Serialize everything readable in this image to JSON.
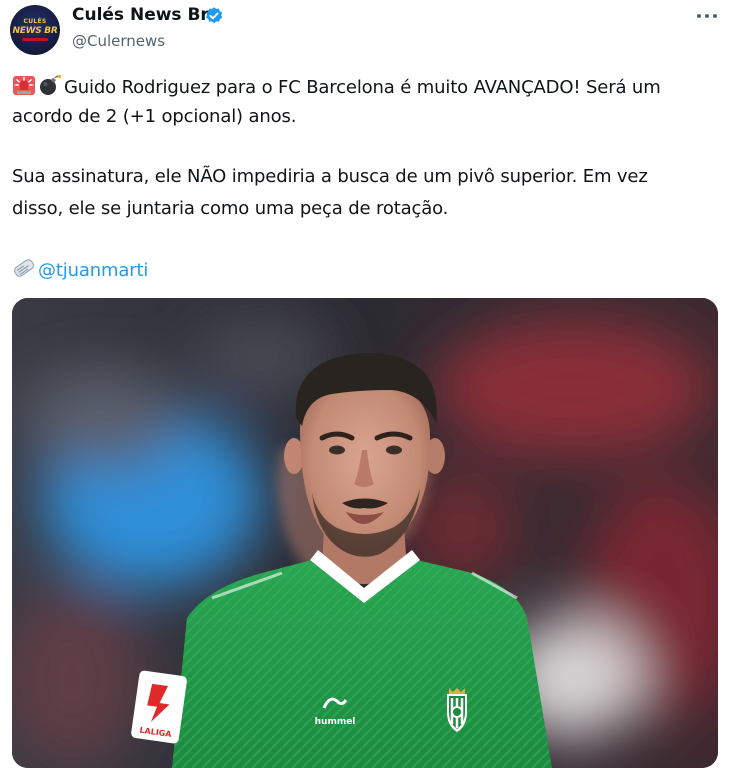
{
  "tweet": {
    "author": {
      "name": "Culés News Br",
      "handle": "@Culernews",
      "avatar_logo": [
        "CULÉS",
        "NEWS BR"
      ],
      "verified": true
    },
    "body": {
      "line1": "Guido Rodriguez para o FC Barcelona é muito AVANÇADO! Será um",
      "line2": "acordo de 2 (+1 opcional) anos.",
      "line3": "Sua assinatura, ele NÃO impediria a busca de um pivô superior. Em vez",
      "line4": "disso, ele se juntaria como uma peça de rotação.",
      "mention": "@tjuanmarti"
    },
    "emojis": [
      "siren-icon",
      "bomb-icon",
      "newspaper-icon"
    ],
    "media": {
      "sponsor_text": "LALIGA",
      "brand_text": "hummel",
      "jersey_color": "#1f9a44"
    }
  },
  "colors": {
    "text": "#0f1419",
    "secondary": "#536471",
    "accent": "#1d9bf0"
  }
}
